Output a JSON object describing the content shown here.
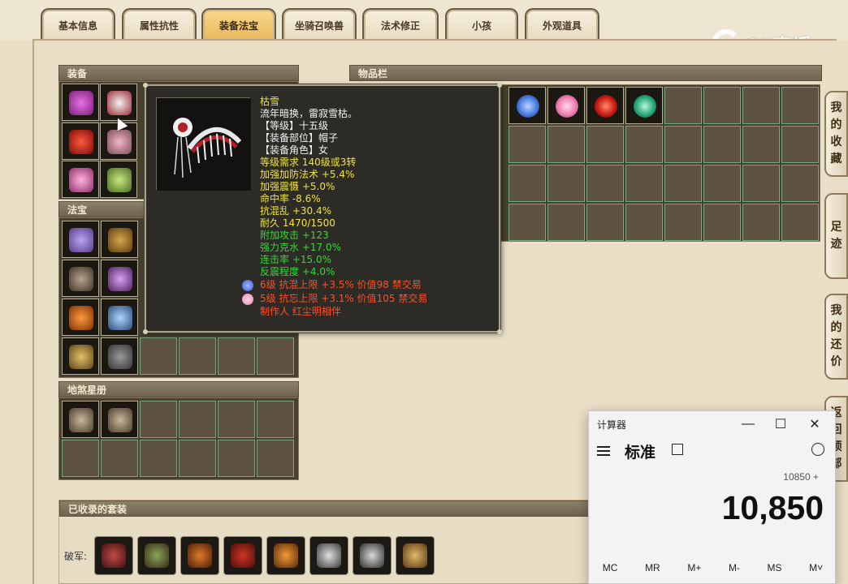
{
  "tabs": [
    {
      "label": "基本信息",
      "active": false
    },
    {
      "label": "属性抗性",
      "active": false
    },
    {
      "label": "装备法宝",
      "active": true
    },
    {
      "label": "坐骑召唤兽",
      "active": false
    },
    {
      "label": "法术修正",
      "active": false
    },
    {
      "label": "小孩",
      "active": false
    },
    {
      "label": "外观道具",
      "active": false
    }
  ],
  "watermark": {
    "text": "CC直播"
  },
  "sections": {
    "equipment": "装备",
    "inventory": "物品栏",
    "treasure": "法宝",
    "stars": "地煞星册",
    "suits": "已收录的套装"
  },
  "tooltip": {
    "name": "枯雪",
    "desc": "流年暗换，雷寂雪枯。",
    "level": "【等级】十五级",
    "slot": "【装备部位】帽子",
    "role": "【装备角色】女",
    "req": "等级需求 140级或3转",
    "attrs_yellow": [
      "加强加防法术 +5.4%",
      "加强震慑 +5.0%",
      "命中率 -8.6%",
      "抗混乱 +30.4%",
      "耐久 1470/1500"
    ],
    "attrs_green": [
      "附加攻击 +123",
      "强力克水 +17.0%",
      "连击率 +15.0%",
      "反震程度 +4.0%"
    ],
    "gems": [
      {
        "text": "6级 抗混上限 +3.5% 价值98 禁交易",
        "color": "#3a5cd6"
      },
      {
        "text": "5级 抗忘上限 +3.1% 价值105 禁交易",
        "color": "#e88ab6"
      }
    ],
    "maker": "制作人 红尘明相伴"
  },
  "inventory_items": [
    {
      "icon": "blue-crystal-icon",
      "color": "#4a7de0"
    },
    {
      "icon": "pink-heart-gem-icon",
      "color": "#ef7fb0"
    },
    {
      "icon": "red-ruby-icon",
      "color": "#c81d12"
    },
    {
      "icon": "green-emerald-icon",
      "color": "#27a979"
    }
  ],
  "suit": {
    "label": "破军:",
    "items": [
      "armor-icon",
      "helmet-icon",
      "necklace-icon",
      "robe-icon",
      "hairpiece-icon",
      "ring-icon",
      "bracelet-icon",
      "belt-icon"
    ]
  },
  "side_buttons": [
    {
      "label": "我的收藏",
      "chars": [
        "我",
        "的",
        "收",
        "藏"
      ]
    },
    {
      "label": "足迹",
      "chars": [
        "足",
        "迹"
      ]
    },
    {
      "label": "我的还价",
      "chars": [
        "我",
        "的",
        "还",
        "价"
      ]
    },
    {
      "label": "返回顶部",
      "chars": [
        "返",
        "回",
        "顶",
        "部"
      ]
    }
  ],
  "calculator": {
    "title": "计算器",
    "mode": "标准",
    "expression": "10850 +",
    "display": "10,850",
    "memory": [
      "MC",
      "MR",
      "M+",
      "M-",
      "MS",
      "M˅"
    ],
    "minimize": "—",
    "maximize": "☐",
    "close": "✕"
  }
}
